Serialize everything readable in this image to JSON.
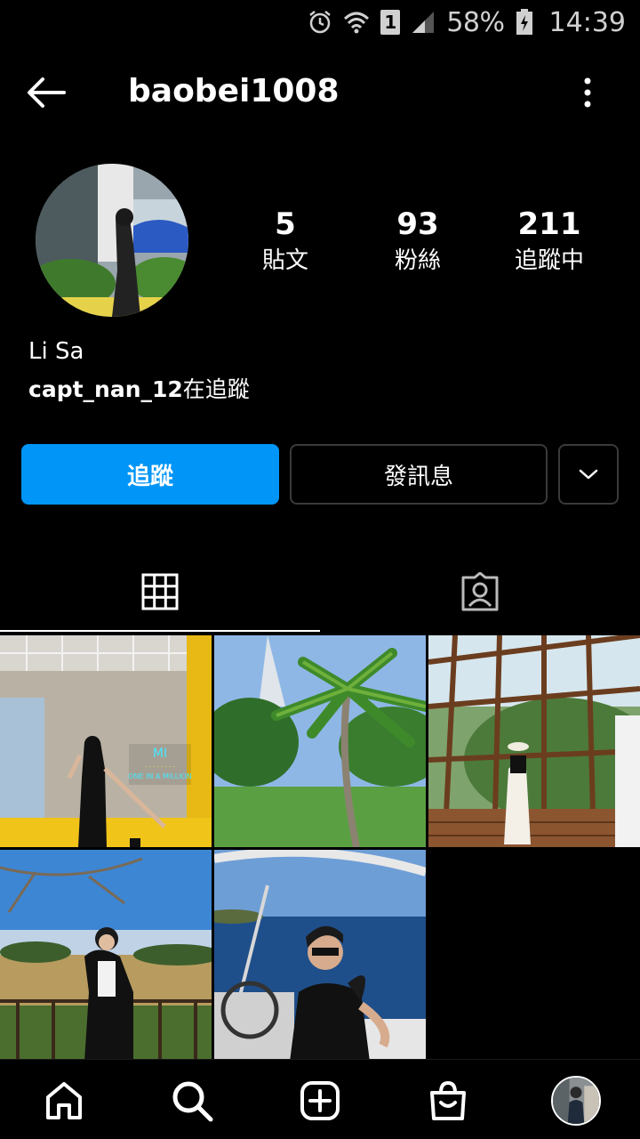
{
  "status_bar": {
    "battery_percent": "58%",
    "time": "14:39",
    "sim_slot": "1"
  },
  "header": {
    "username": "baobei1008"
  },
  "profile": {
    "display_name": "Li Sa",
    "followed_by_user": "capt_nan_12",
    "followed_by_suffix": "在追蹤",
    "stats": [
      {
        "value": "5",
        "label": "貼文"
      },
      {
        "value": "93",
        "label": "粉絲"
      },
      {
        "value": "211",
        "label": "追蹤中"
      }
    ]
  },
  "actions": {
    "follow_label": "追蹤",
    "message_label": "發訊息"
  },
  "tabs": [
    {
      "icon": "grid-icon",
      "active": true
    },
    {
      "icon": "tagged-icon",
      "active": false
    }
  ],
  "posts": [
    {
      "scene": "indoor-neon-sign",
      "neon_text": "ONE IN A MILLION"
    },
    {
      "scene": "palm-tree-park"
    },
    {
      "scene": "glass-greenhouse"
    },
    {
      "scene": "vineyard-terrace"
    },
    {
      "scene": "boat-sea"
    }
  ],
  "colors": {
    "accent": "#0095f6",
    "background": "#000000",
    "border": "#3a3a3a"
  },
  "bottom_nav": [
    "home-icon",
    "search-icon",
    "create-icon",
    "shop-icon",
    "profile-avatar"
  ]
}
